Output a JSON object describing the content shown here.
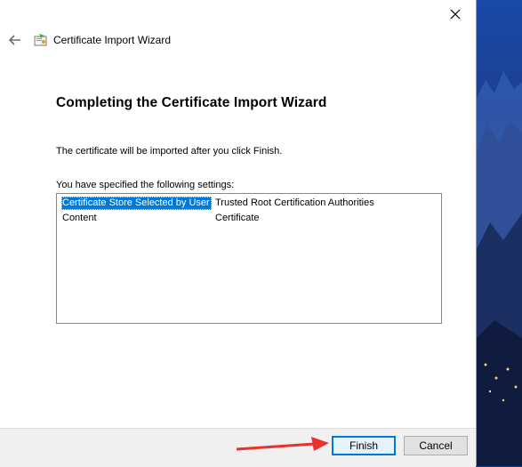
{
  "window": {
    "title": "Certificate Import Wizard",
    "close_label": "✕",
    "back_label": "←"
  },
  "main": {
    "heading": "Completing the Certificate Import Wizard",
    "description": "The certificate will be imported after you click Finish.",
    "settings_label": "You have specified the following settings:",
    "settings": [
      {
        "key": "Certificate Store Selected by User",
        "value": "Trusted Root Certification Authorities",
        "selected": true
      },
      {
        "key": "Content",
        "value": "Certificate",
        "selected": false
      }
    ]
  },
  "footer": {
    "finish_label": "Finish",
    "cancel_label": "Cancel"
  },
  "colors": {
    "accent": "#0078d7",
    "annotation_arrow": "#e8322b"
  },
  "icons": [
    "close-icon",
    "back-arrow-icon",
    "certificate-wizard-icon",
    "annotation-arrow"
  ]
}
